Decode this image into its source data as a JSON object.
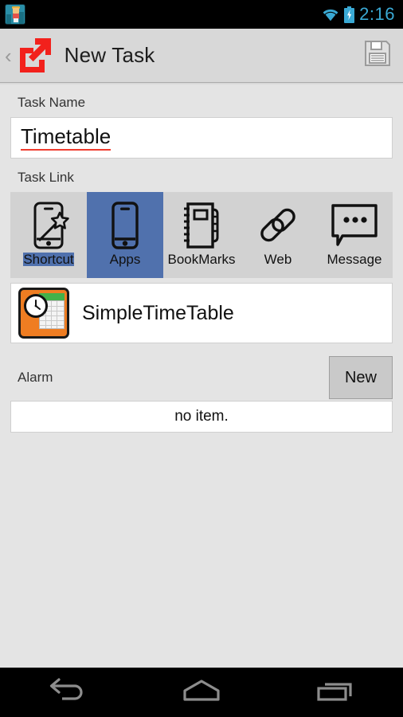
{
  "statusbar": {
    "notification_icon": "pixel-character-app-icon",
    "wifi_icon": "wifi-icon",
    "battery_icon": "battery-charging-icon",
    "time": "2:16",
    "accent_color": "#3aa9d4"
  },
  "actionbar": {
    "up_caret": "‹",
    "logo_icon": "shortcut-external-link-icon",
    "logo_color": "#f2211c",
    "title": "New Task",
    "save_icon": "floppy-disk-save-icon"
  },
  "form": {
    "task_name_label": "Task Name",
    "task_name_value": "Timetable",
    "task_name_placeholder": "Task Name",
    "spellcheck_underline_color": "#f03c2e",
    "task_link_label": "Task Link"
  },
  "task_link_tabs": {
    "selected_index": 1,
    "selected_color": "#5071ad",
    "items": [
      {
        "label": "Shortcut",
        "icon": "phone-magic-wand-icon",
        "selected": false
      },
      {
        "label": "Apps",
        "icon": "phone-icon",
        "selected": true
      },
      {
        "label": "BookMarks",
        "icon": "notebook-icon",
        "selected": false
      },
      {
        "label": "Web",
        "icon": "chain-link-icon",
        "selected": false
      },
      {
        "label": "Message",
        "icon": "speech-bubble-icon",
        "selected": false
      }
    ]
  },
  "selected_app": {
    "name": "SimpleTimeTable",
    "icon": "clock-timetable-app-icon",
    "icon_bg_color": "#ef7d22"
  },
  "alarm": {
    "label": "Alarm",
    "new_button": "New",
    "empty_text": "no item."
  },
  "navbar": {
    "back": "back-icon",
    "home": "home-icon",
    "recents": "recents-icon"
  }
}
